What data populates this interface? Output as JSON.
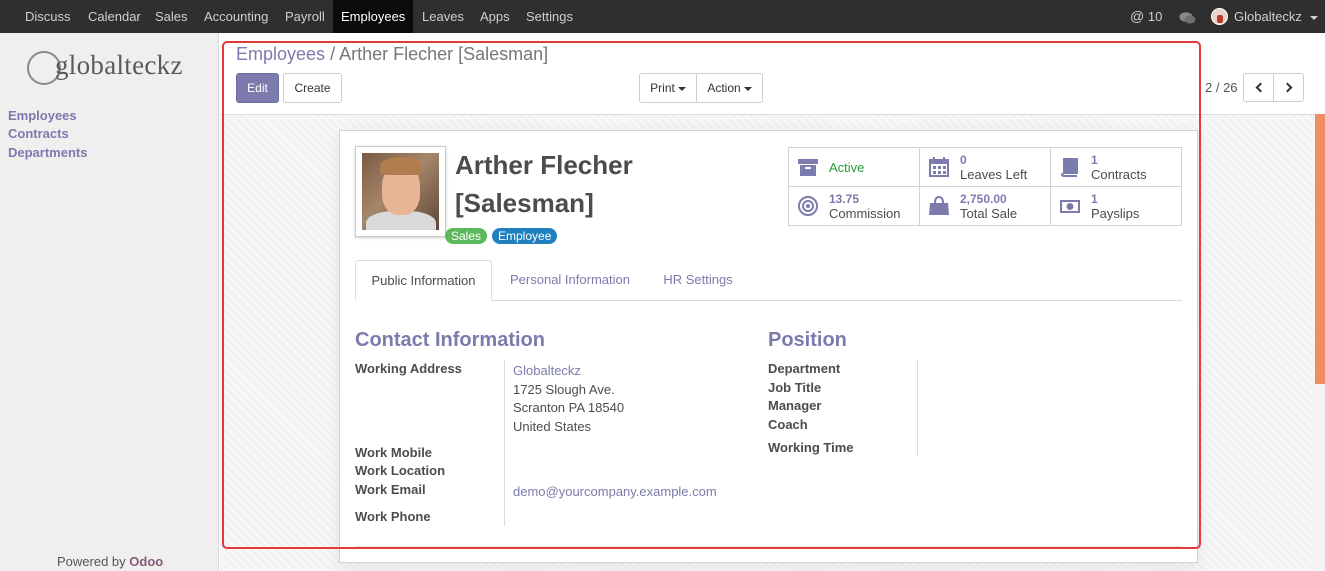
{
  "topbar": {
    "menu": [
      "Discuss",
      "Calendar",
      "Sales",
      "Accounting",
      "Payroll",
      "Employees",
      "Leaves",
      "Apps",
      "Settings"
    ],
    "active_item": "Employees",
    "mentions_count": "10",
    "user_name": "Globalteckz"
  },
  "sidebar": {
    "logo_text": "globalteckz",
    "links": [
      "Employees",
      "Contracts",
      "Departments"
    ],
    "powered_prefix": "Powered by",
    "powered_brand": "Odoo"
  },
  "control_panel": {
    "breadcrumb_parent": "Employees",
    "breadcrumb_sep": "/",
    "breadcrumb_current": "Arther Flecher [Salesman]",
    "edit_label": "Edit",
    "create_label": "Create",
    "print_label": "Print",
    "action_label": "Action",
    "pager": "2 / 26"
  },
  "employee": {
    "name": "Arther Flecher [Salesman]",
    "tags": [
      {
        "label": "Sales",
        "color": "#5cb85c"
      },
      {
        "label": "Employee",
        "color": "#1f7fbf"
      }
    ]
  },
  "smart_buttons": [
    {
      "value": "",
      "label": "Active",
      "icon": "archive-icon"
    },
    {
      "value": "0",
      "label": "Leaves Left",
      "icon": "calendar-icon"
    },
    {
      "value": "1",
      "label": "Contracts",
      "icon": "book-icon"
    },
    {
      "value": "13.75",
      "label": "Commission",
      "icon": "target-icon"
    },
    {
      "value": "2,750.00",
      "label": "Total Sale",
      "icon": "shopping-bag-icon"
    },
    {
      "value": "1",
      "label": "Payslips",
      "icon": "money-icon"
    }
  ],
  "tabs": [
    "Public Information",
    "Personal Information",
    "HR Settings"
  ],
  "contact": {
    "title": "Contact Information",
    "working_address_label": "Working Address",
    "address": [
      "Globalteckz",
      "1725 Slough Ave.",
      "Scranton PA 18540",
      "United States"
    ],
    "work_mobile_label": "Work Mobile",
    "work_location_label": "Work Location",
    "work_email_label": "Work Email",
    "work_email": "demo@yourcompany.example.com",
    "work_phone_label": "Work Phone"
  },
  "position": {
    "title": "Position",
    "fields": [
      "Department",
      "Job Title",
      "Manager",
      "Coach"
    ],
    "working_time_label": "Working Time"
  },
  "colors": {
    "accent": "#7c7bad",
    "highlight_box": "#e33b3b",
    "topbar": "#2f2f2f"
  }
}
